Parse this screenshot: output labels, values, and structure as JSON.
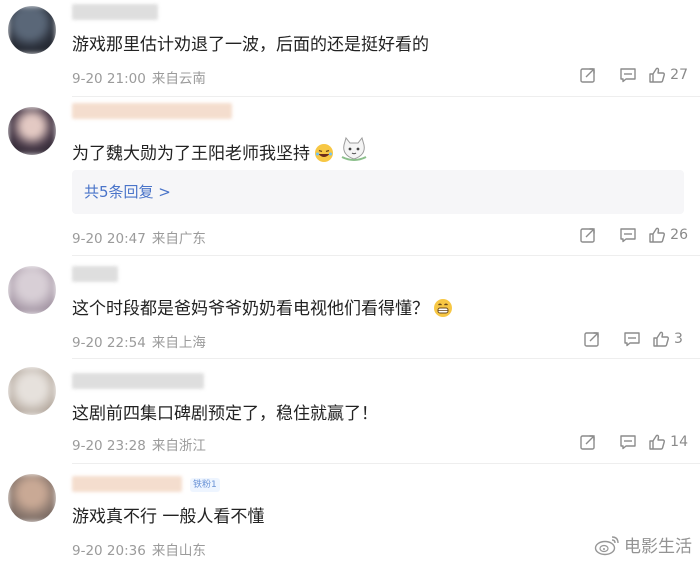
{
  "comments": [
    {
      "text": "游戏那里估计劝退了一波，后面的还是挺好看的",
      "date": "9-20 21:00",
      "location": "来自云南",
      "likes": "27"
    },
    {
      "text": "为了魏大勋为了王阳老师我坚持",
      "replies_label": "共5条回复 >",
      "date": "9-20 20:47",
      "location": "来自广东",
      "likes": "26"
    },
    {
      "text": "这个时段都是爸妈爷爷奶奶看电视他们看得懂？",
      "date": "9-20 22:54",
      "location": "来自上海",
      "likes": "3"
    },
    {
      "text": "这剧前四集口碑剧预定了，稳住就赢了！",
      "date": "9-20 23:28",
      "location": "来自浙江",
      "likes": "14"
    },
    {
      "text": "游戏真不行 一般人看不懂",
      "badge": "铁粉1",
      "date": "9-20 20:36",
      "location": "来自山东"
    }
  ],
  "watermark": {
    "text": "电影生活"
  },
  "icons": {
    "share": "share-icon",
    "comment": "comment-icon",
    "like": "thumbs-up-icon",
    "laugh": "laugh-emoji",
    "cat": "cat-sticker-icon"
  }
}
